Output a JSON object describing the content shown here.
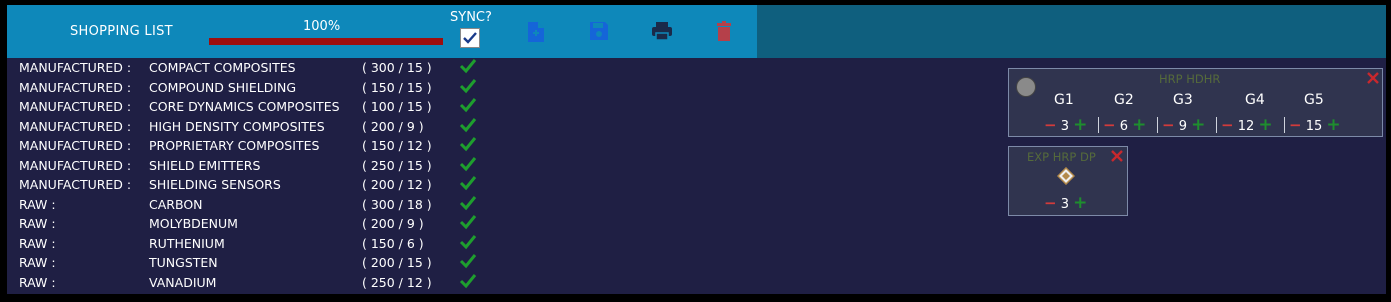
{
  "header": {
    "title": "SHOPPING LIST",
    "progress_label": "100%",
    "progress_fraction": 1.0,
    "sync_label": "SYNC?",
    "sync_checked": true,
    "toolbar_icons": [
      "new-file-icon",
      "save-icon",
      "print-icon",
      "delete-icon"
    ]
  },
  "rows": [
    {
      "category": "MANUFACTURED :",
      "name": "COMPACT COMPOSITES",
      "qty": "( 300 / 15 )"
    },
    {
      "category": "MANUFACTURED :",
      "name": "COMPOUND SHIELDING",
      "qty": "( 150 / 15 )"
    },
    {
      "category": "MANUFACTURED :",
      "name": "CORE DYNAMICS COMPOSITES",
      "qty": "( 100 / 15 )"
    },
    {
      "category": "MANUFACTURED :",
      "name": "HIGH DENSITY COMPOSITES",
      "qty": "( 200 / 9 )"
    },
    {
      "category": "MANUFACTURED :",
      "name": "PROPRIETARY COMPOSITES",
      "qty": "( 150 / 12 )"
    },
    {
      "category": "MANUFACTURED :",
      "name": "SHIELD EMITTERS",
      "qty": "( 250 / 15 )"
    },
    {
      "category": "MANUFACTURED :",
      "name": "SHIELDING SENSORS",
      "qty": "( 200 / 12 )"
    },
    {
      "category": "RAW :",
      "name": "CARBON",
      "qty": "( 300 / 18 )"
    },
    {
      "category": "RAW :",
      "name": "MOLYBDENUM",
      "qty": "( 200 / 9 )"
    },
    {
      "category": "RAW :",
      "name": "RUTHENIUM",
      "qty": "( 150 / 6 )"
    },
    {
      "category": "RAW :",
      "name": "TUNGSTEN",
      "qty": "( 200 / 15 )"
    },
    {
      "category": "RAW :",
      "name": "VANADIUM",
      "qty": "( 250 / 12 )"
    }
  ],
  "panel_hrp": {
    "title": "HRP HDHR",
    "grades": [
      {
        "label": "G1",
        "value": "3"
      },
      {
        "label": "G2",
        "value": "6"
      },
      {
        "label": "G3",
        "value": "9"
      },
      {
        "label": "G4",
        "value": "12"
      },
      {
        "label": "G5",
        "value": "15"
      }
    ]
  },
  "panel_exp": {
    "title": "EXP HRP DP",
    "value": "3"
  },
  "colors": {
    "header_bg": "#0e88ba",
    "body_bg": "#1f1f44",
    "progress_fill": "#9d0e0e",
    "check": "#1e9e2e",
    "minus": "#d23b3b",
    "plus": "#1e8e2e"
  }
}
